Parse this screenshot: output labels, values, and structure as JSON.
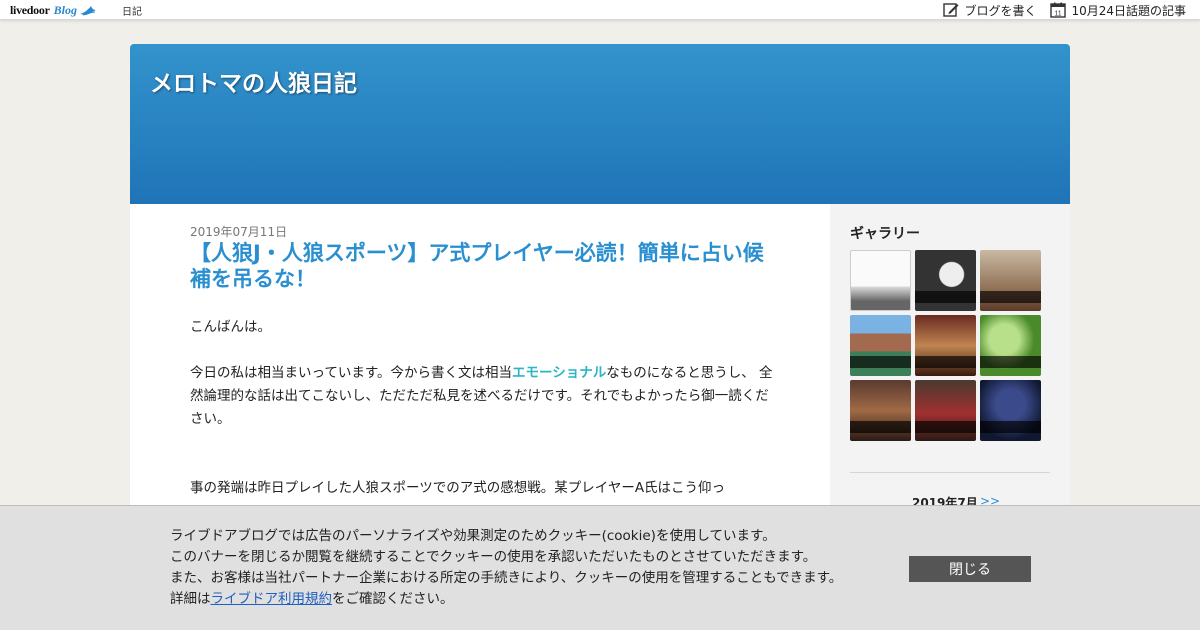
{
  "topbar": {
    "logo_text": "livedoor",
    "logo_blog": "Blog",
    "diary_label": "日記",
    "write_blog_label": "ブログを書く",
    "calendar_icon_day": "11",
    "topic_label": "10月24日話題の記事"
  },
  "blog": {
    "title": "メロトマの人狼日記"
  },
  "post": {
    "date": "2019年07月11日",
    "title": "【人狼J・人狼スポーツ】ア式プレイヤー必読！簡単に占い候補を吊るな！",
    "greeting": "こんばんは。",
    "para1_before": "今日の私は相当まいっています。今から書く文は相当",
    "para1_emph": "エモーショナル",
    "para1_after": "なものになると思うし、 全然論理的な話は出てこないし、ただただ私見を述べるだけです。それでもよかったら御一読ください。",
    "para2": "事の発端は昨日プレイした人狼スポーツでのア式の感想戦。某プレイヤーA氏はこう仰っ"
  },
  "sidebar": {
    "gallery_title": "ギャラリー",
    "calendar_month": "2019年7月",
    "calendar_next": ">>"
  },
  "cookie": {
    "line1": "ライブドアブログでは広告のパーソナライズや効果測定のためクッキー(cookie)を使用しています。",
    "line2": "このバナーを閉じるか閲覧を継続することでクッキーの使用を承認いただいたものとさせていただきます。",
    "line3": "また、お客様は当社パートナー企業における所定の手続きにより、クッキーの使用を管理することもできます。",
    "line4_before": "詳細は",
    "line4_link": "ライブドア利用規約",
    "line4_after": "をご確認ください。",
    "close_label": "閉じる"
  },
  "colors": {
    "header_top": "#3393cc",
    "header_bottom": "#1f74b7",
    "title_link": "#2a8fd0",
    "emphasis": "#2bb5c5",
    "close_button": "#555555"
  },
  "icons": {
    "logo_bird": "bird-icon",
    "write": "pencil-edit-icon",
    "calendar": "calendar-icon"
  }
}
